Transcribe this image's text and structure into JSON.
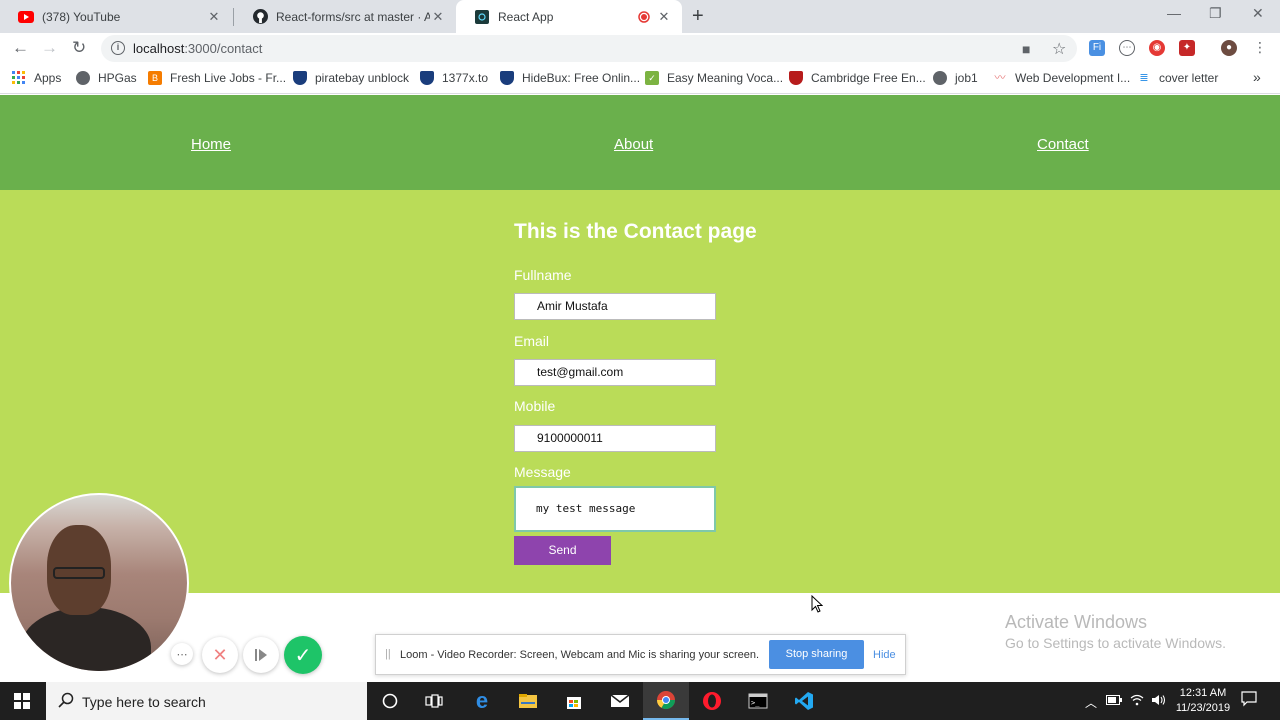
{
  "browser": {
    "tabs": [
      {
        "title": "(378) YouTube"
      },
      {
        "title": "React-forms/src at master · Amir"
      },
      {
        "title": "React App"
      }
    ],
    "url_host": "localhost",
    "url_path": ":3000/contact",
    "bookmarks": [
      {
        "label": "Apps"
      },
      {
        "label": "HPGas"
      },
      {
        "label": "Fresh Live Jobs - Fr..."
      },
      {
        "label": "piratebay unblock"
      },
      {
        "label": "1377x.to"
      },
      {
        "label": "HideBux: Free Onlin..."
      },
      {
        "label": "Easy Meaning Voca..."
      },
      {
        "label": "Cambridge Free En..."
      },
      {
        "label": "job1"
      },
      {
        "label": "Web Development I..."
      },
      {
        "label": "cover letter"
      }
    ],
    "bookmarks_overflow": "»"
  },
  "nav": {
    "home": "Home",
    "about": "About",
    "contact": "Contact"
  },
  "contact": {
    "title": "This is the Contact page",
    "fullname_label": "Fullname",
    "fullname_value": "Amir Mustafa",
    "email_label": "Email",
    "email_value": "test@gmail.com",
    "mobile_label": "Mobile",
    "mobile_value": "9100000011",
    "message_label": "Message",
    "message_value": "my test message",
    "send_label": "Send"
  },
  "windows_watermark": {
    "line1": "Activate Windows",
    "line2": "Go to Settings to activate Windows."
  },
  "loom": {
    "message": "Loom - Video Recorder: Screen, Webcam and Mic is sharing your screen.",
    "stop_label": "Stop sharing",
    "hide_label": "Hide"
  },
  "taskbar": {
    "search_placeholder": "Type here to search",
    "time": "12:31 AM",
    "date": "11/23/2019"
  },
  "colors": {
    "navbar": "#6ab04c",
    "content": "#badc58",
    "send_button": "#8e44ad",
    "stop_sharing": "#4b8fe2"
  }
}
